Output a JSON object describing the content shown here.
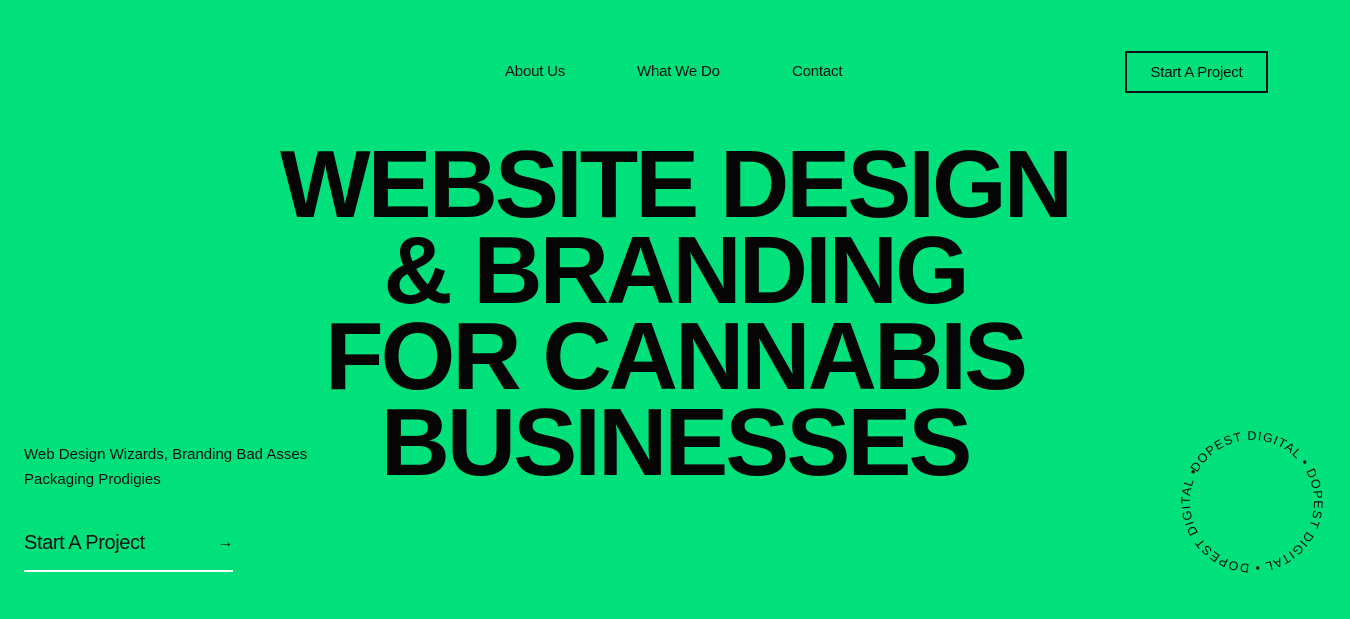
{
  "nav": {
    "links": [
      "About Us",
      "What We Do",
      "Contact"
    ],
    "cta_label": "Start A Project"
  },
  "hero": {
    "lines": [
      "WEBSITE DESIGN",
      "& BRANDING",
      "FOR CANNABIS",
      "BUSINESSES"
    ]
  },
  "tagline": {
    "line1": "Web Design Wizards, Branding Bad Asses",
    "line2": "Packaging Prodigies"
  },
  "cta_link": {
    "label": "Start A Project",
    "arrow_icon": "arrow-right-icon",
    "arrow_glyph": "→"
  },
  "badge": {
    "text": "DOPEST DIGITAL • DOPEST DIGITAL • DOPEST DIGITAL • ",
    "icon": "rotating-badge-icon"
  },
  "colors": {
    "background": "#00E07B",
    "text": "#0B0B0B",
    "underline": "#F4FFF8"
  }
}
